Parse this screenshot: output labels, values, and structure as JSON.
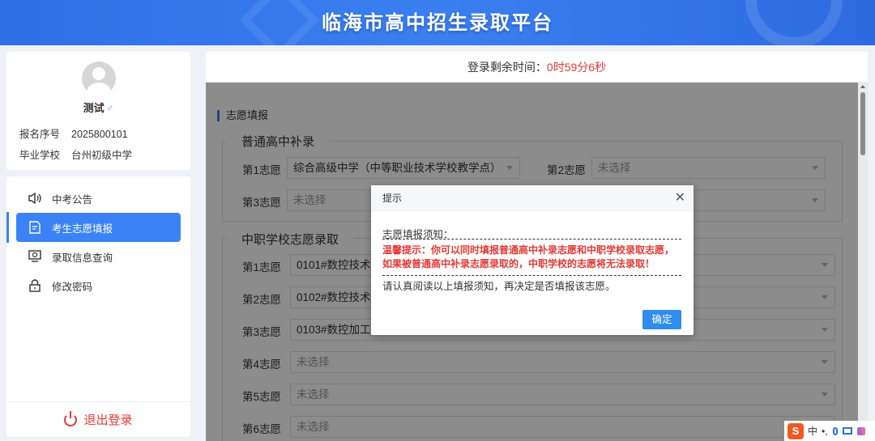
{
  "header": {
    "title": "临海市高中招生录取平台"
  },
  "user": {
    "name": "测试",
    "gender_symbol": "♂",
    "reg_no_label": "报名序号",
    "reg_no": "2025800101",
    "school_label": "毕业学校",
    "school": "台州初级中学"
  },
  "menu": {
    "items": [
      {
        "label": "中考公告",
        "icon": "speaker-icon"
      },
      {
        "label": "考生志愿填报",
        "icon": "edit-form-icon"
      },
      {
        "label": "录取信息查询",
        "icon": "monitor-search-icon"
      },
      {
        "label": "修改密码",
        "icon": "lock-icon"
      }
    ],
    "logout": "退出登录"
  },
  "timer": {
    "label": "登录剩余时间：",
    "value": "0时59分6秒"
  },
  "form": {
    "section_title": "志愿填报",
    "general": {
      "legend": "普通高中补录",
      "rows": [
        {
          "label": "第1志愿",
          "value": "综合高级中学（中等职业技术学校教学点）"
        },
        {
          "label": "第2志愿",
          "value": "未选择"
        },
        {
          "label": "第3志愿",
          "value": "未选择"
        }
      ]
    },
    "vocational": {
      "legend": "中职学校志愿录取",
      "rows": [
        {
          "label": "第1志愿",
          "value": "0101#数控技术"
        },
        {
          "label": "第2志愿",
          "value": "0102#数控技术"
        },
        {
          "label": "第3志愿",
          "value": "0103#数控加工"
        },
        {
          "label": "第4志愿",
          "value": "未选择"
        },
        {
          "label": "第5志愿",
          "value": "未选择"
        },
        {
          "label": "第6志愿",
          "value": "未选择"
        }
      ]
    }
  },
  "dialog": {
    "title": "提示",
    "close": "✕",
    "notice_label": "志愿填报须知：",
    "warning_line1": "温馨提示：你可以同时填报普通高中补录志愿和中职学校录取志愿，",
    "warning_line2": "如果被普通高中补录志愿录取的，中职学校的志愿将无法录取！",
    "read_note": "请认真阅读以上填报须知，再决定是否填报该志愿。",
    "confirm": "确定"
  },
  "ime": {
    "logo": "S",
    "mode": "中",
    "punct": "•,"
  }
}
